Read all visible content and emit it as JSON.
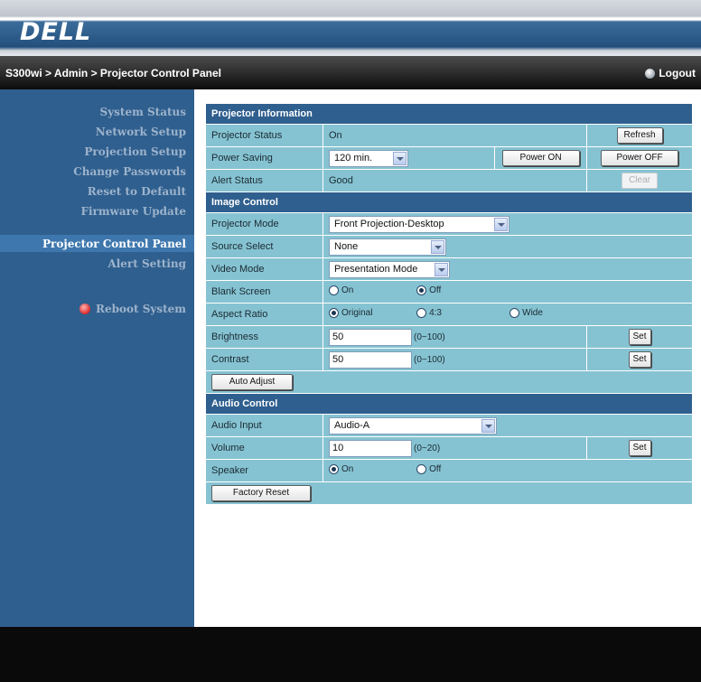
{
  "header": {
    "logo": "DELL",
    "breadcrumb": "S300wi > Admin > Projector Control Panel",
    "logout": "Logout"
  },
  "sidebar": {
    "items": [
      {
        "label": "System Status"
      },
      {
        "label": "Network Setup"
      },
      {
        "label": "Projection Setup"
      },
      {
        "label": "Change Passwords"
      },
      {
        "label": "Reset to Default"
      },
      {
        "label": "Firmware Update"
      },
      {
        "label": "Projector Control Panel",
        "active": true
      },
      {
        "label": "Alert Setting"
      }
    ],
    "reboot": "Reboot System"
  },
  "projector_info": {
    "title": "Projector Information",
    "status_label": "Projector Status",
    "status_value": "On",
    "refresh": "Refresh",
    "power_saving_label": "Power Saving",
    "power_saving_value": "120 min.",
    "power_on": "Power ON",
    "power_off": "Power OFF",
    "alert_label": "Alert Status",
    "alert_value": "Good",
    "clear": "Clear"
  },
  "image_control": {
    "title": "Image Control",
    "mode_label": "Projector Mode",
    "mode_value": "Front Projection-Desktop",
    "source_label": "Source Select",
    "source_value": "None",
    "video_label": "Video Mode",
    "video_value": "Presentation Mode",
    "blank_label": "Blank Screen",
    "blank_on": "On",
    "blank_off": "Off",
    "blank_selected": "Off",
    "aspect_label": "Aspect Ratio",
    "aspect_original": "Original",
    "aspect_43": "4:3",
    "aspect_wide": "Wide",
    "aspect_selected": "Original",
    "brightness_label": "Brightness",
    "brightness_value": "50",
    "brightness_range": "(0~100)",
    "contrast_label": "Contrast",
    "contrast_value": "50",
    "contrast_range": "(0~100)",
    "set": "Set",
    "auto_adjust": "Auto Adjust"
  },
  "audio_control": {
    "title": "Audio Control",
    "input_label": "Audio Input",
    "input_value": "Audio-A",
    "volume_label": "Volume",
    "volume_value": "10",
    "volume_range": "(0~20)",
    "speaker_label": "Speaker",
    "speaker_on": "On",
    "speaker_off": "Off",
    "speaker_selected": "On",
    "set": "Set",
    "factory_reset": "Factory Reset"
  },
  "colors": {
    "sidebar_bg": "#2f5f8e",
    "row_bg": "#86c3d2",
    "section_bg": "#2f5f8e",
    "footer_bg": "#0a0a0a"
  }
}
